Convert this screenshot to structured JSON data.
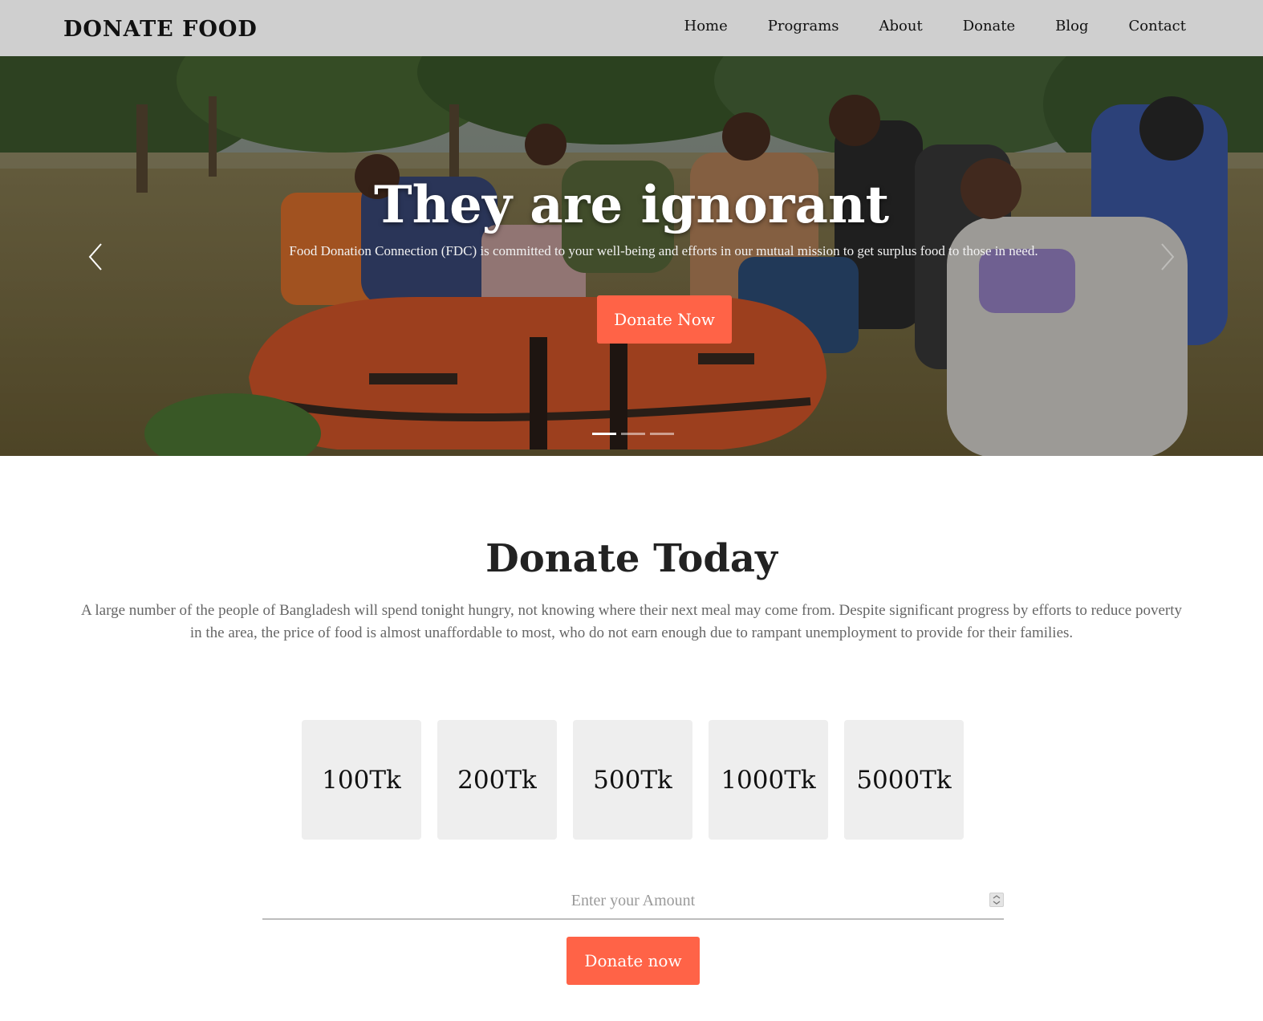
{
  "navbar": {
    "brand": "DONATE FOOD",
    "links": [
      "Home",
      "Programs",
      "About",
      "Donate",
      "Blog",
      "Contact"
    ]
  },
  "hero": {
    "title": "They are ignorant",
    "text": "Food Donation Connection (FDC) is committed to your well-being and efforts in our mutual mission to get surplus food to those in need.",
    "button": "Donate Now",
    "prev_icon": "chevron-left-icon",
    "next_icon": "chevron-right-icon",
    "slides": 3,
    "active_slide": 1
  },
  "donate": {
    "title": "Donate Today",
    "description": "A large number of the people of Bangladesh will spend tonight hungry, not knowing where their next meal may come from. Despite significant progress by efforts to reduce poverty in the area, the price of food is almost unaffordable to most, who do not earn enough due to rampant unemployment to provide for their families.",
    "amounts": [
      "100Tk",
      "200Tk",
      "500Tk",
      "1000Tk",
      "5000Tk"
    ],
    "input_placeholder": "Enter your Amount",
    "input_value": "",
    "submit": "Donate now"
  },
  "colors": {
    "accent": "#ff6347",
    "navbar_bg": "#cfcfcf",
    "box_bg": "#eeeeee"
  }
}
